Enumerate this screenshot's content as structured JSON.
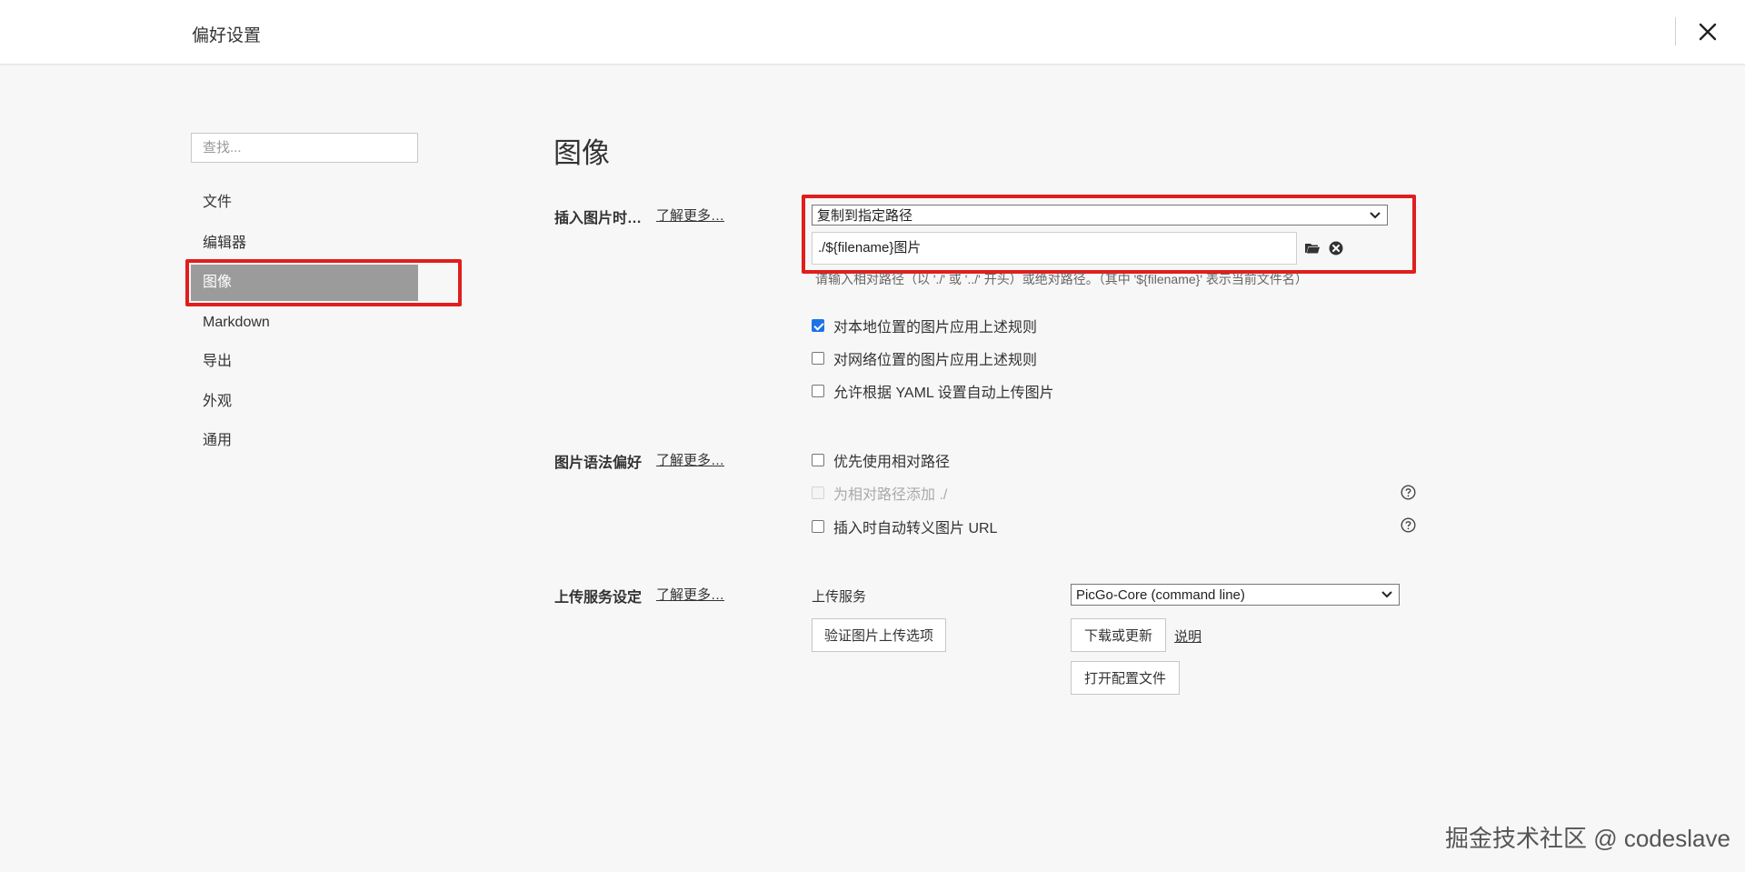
{
  "header": {
    "title": "偏好设置"
  },
  "sidebar": {
    "search_placeholder": "查找...",
    "items": [
      {
        "label": "文件"
      },
      {
        "label": "编辑器"
      },
      {
        "label": "图像",
        "active": true
      },
      {
        "label": "Markdown"
      },
      {
        "label": "导出"
      },
      {
        "label": "外观"
      },
      {
        "label": "通用"
      }
    ]
  },
  "main": {
    "title": "图像",
    "insert_section": {
      "label": "插入图片时…",
      "learn_more": "了解更多…",
      "action_select_value": "复制到指定路径",
      "path_value": "./${filename}图片",
      "hint": "请输入相对路径（以 './' 或 '../' 开头）或绝对路径。（其中 '${filename}' 表示当前文件名）",
      "checkboxes": [
        {
          "label": "对本地位置的图片应用上述规则",
          "checked": true
        },
        {
          "label": "对网络位置的图片应用上述规则",
          "checked": false
        },
        {
          "label": "允许根据 YAML 设置自动上传图片",
          "checked": false
        }
      ]
    },
    "syntax_section": {
      "label": "图片语法偏好",
      "learn_more": "了解更多…",
      "checkboxes": [
        {
          "label": "优先使用相对路径",
          "checked": false
        },
        {
          "label": "为相对路径添加 ./",
          "checked": false,
          "disabled": true
        },
        {
          "label": "插入时自动转义图片 URL",
          "checked": false
        }
      ]
    },
    "upload_section": {
      "label": "上传服务设定",
      "learn_more": "了解更多…",
      "service_label": "上传服务",
      "service_value": "PicGo-Core (command line)",
      "verify_button": "验证图片上传选项",
      "download_button": "下载或更新",
      "explain_link": "说明",
      "open_config_button": "打开配置文件"
    }
  },
  "watermark": "掘金技术社区 @ codeslave",
  "colors": {
    "highlight_box": "#e01e1e",
    "active_item_bg": "#9b9b9b",
    "checkbox_checked": "#1a73e8"
  }
}
